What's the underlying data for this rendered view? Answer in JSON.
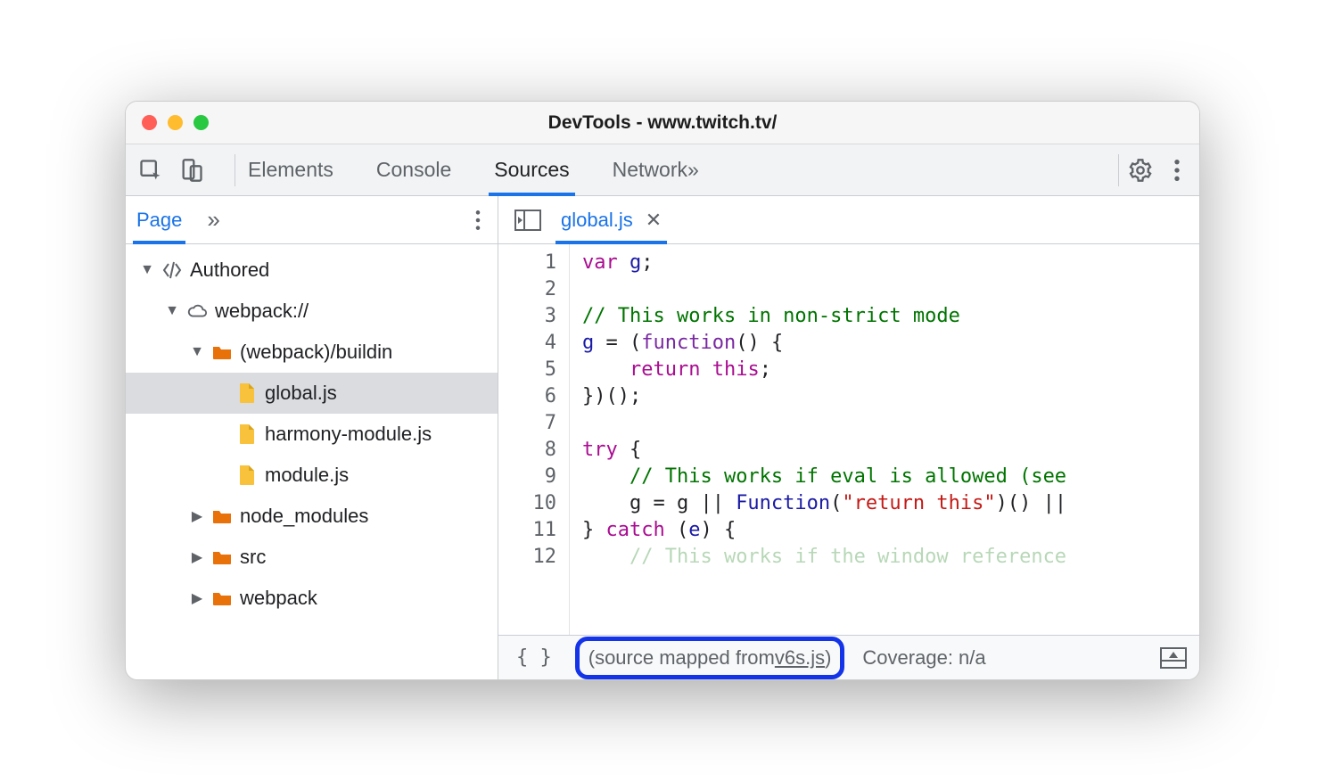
{
  "window": {
    "title": "DevTools - www.twitch.tv/"
  },
  "main_tabs": {
    "items": [
      "Elements",
      "Console",
      "Sources",
      "Network"
    ],
    "active_index": 2,
    "more": "»"
  },
  "sidebar": {
    "tab": "Page",
    "more": "»",
    "tree": [
      {
        "depth": 0,
        "kind": "authored",
        "label": "Authored",
        "expanded": true
      },
      {
        "depth": 1,
        "kind": "cloud",
        "label": "webpack://",
        "expanded": true
      },
      {
        "depth": 2,
        "kind": "folder",
        "label": "(webpack)/buildin",
        "expanded": true
      },
      {
        "depth": 3,
        "kind": "file",
        "label": "global.js",
        "selected": true
      },
      {
        "depth": 3,
        "kind": "file",
        "label": "harmony-module.js"
      },
      {
        "depth": 3,
        "kind": "file",
        "label": "module.js"
      },
      {
        "depth": 2,
        "kind": "folder",
        "label": "node_modules",
        "expanded": false
      },
      {
        "depth": 2,
        "kind": "folder",
        "label": "src",
        "expanded": false
      },
      {
        "depth": 2,
        "kind": "folder",
        "label": "webpack",
        "expanded": false
      }
    ]
  },
  "editor": {
    "open_file": "global.js",
    "line_count": 12,
    "code_tokens": [
      [
        {
          "t": "var ",
          "c": "kw"
        },
        {
          "t": "g",
          "c": "id"
        },
        {
          "t": ";"
        }
      ],
      [],
      [
        {
          "t": "// This works in non-strict mode",
          "c": "cm"
        }
      ],
      [
        {
          "t": "g",
          "c": "id"
        },
        {
          "t": " = ("
        },
        {
          "t": "function",
          "c": "fn"
        },
        {
          "t": "() {"
        }
      ],
      [
        {
          "t": "    "
        },
        {
          "t": "return ",
          "c": "kw"
        },
        {
          "t": "this",
          "c": "kw"
        },
        {
          "t": ";"
        }
      ],
      [
        {
          "t": "})();"
        }
      ],
      [],
      [
        {
          "t": "try",
          "c": "kw"
        },
        {
          "t": " {"
        }
      ],
      [
        {
          "t": "    "
        },
        {
          "t": "// This works if eval is allowed (see",
          "c": "cm"
        }
      ],
      [
        {
          "t": "    g = g || "
        },
        {
          "t": "Function",
          "c": "id"
        },
        {
          "t": "("
        },
        {
          "t": "\"return this\"",
          "c": "st"
        },
        {
          "t": ")() ||"
        }
      ],
      [
        {
          "t": "} "
        },
        {
          "t": "catch",
          "c": "kw"
        },
        {
          "t": " ("
        },
        {
          "t": "e",
          "c": "id"
        },
        {
          "t": ") {"
        }
      ],
      [
        {
          "t": "    "
        },
        {
          "t": "// This works if the window reference",
          "c": "cm"
        }
      ]
    ],
    "faded_lines": [
      12
    ]
  },
  "status": {
    "pretty_print": "{ }",
    "mapped_prefix": "(source mapped from ",
    "mapped_file": "v6s.js",
    "mapped_suffix": ")",
    "coverage": "Coverage: n/a"
  }
}
